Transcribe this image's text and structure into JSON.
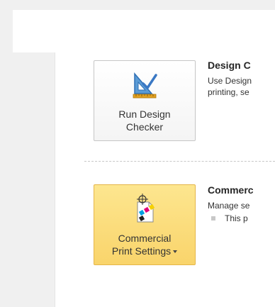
{
  "design_checker": {
    "button_label_line1": "Run Design",
    "button_label_line2": "Checker",
    "title": "Design C",
    "text_line1": "Use Design",
    "text_line2": "printing, se"
  },
  "commercial_print": {
    "button_label_line1": "Commercial",
    "button_label_line2": "Print Settings",
    "title": "Commerc",
    "text_line1": "Manage se",
    "bullet_text": "This p"
  },
  "colors": {
    "panel_gray": "#f0f0f0",
    "button_highlight": "#f9d46b",
    "icon_blue": "#3a78c4",
    "icon_gold": "#e0a020"
  }
}
